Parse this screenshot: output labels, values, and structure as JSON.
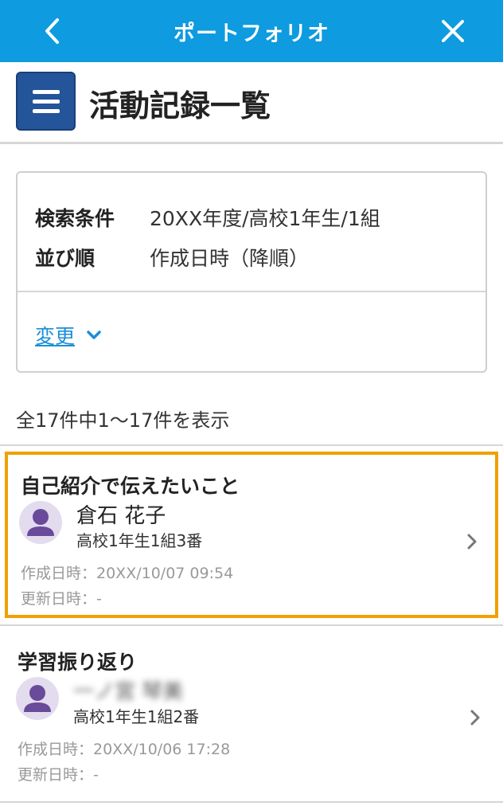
{
  "topbar": {
    "title": "ポートフォリオ",
    "back_icon": "chevron-left-icon",
    "close_icon": "close-icon",
    "color": "#0e9be0"
  },
  "header": {
    "menu_icon": "hamburger-menu-icon",
    "title": "活動記録一覧"
  },
  "search": {
    "condition_label": "検索条件",
    "condition_value": "20XX年度/高校1年生/1組",
    "order_label": "並び順",
    "order_value": "作成日時（降順）",
    "change_label": "変更"
  },
  "count_text": "全17件中1～17件を表示",
  "items": [
    {
      "title": "自己紹介で伝えたいこと",
      "name": "倉石 花子",
      "grade": "高校1年生1組3番",
      "created": "作成日時：20XX/10/07 09:54",
      "updated": "更新日時：-",
      "selected": true
    },
    {
      "title": "学習振り返り",
      "name": "一ノ宮 琴美",
      "grade": "高校1年生1組2番",
      "created": "作成日時：20XX/10/06 17:28",
      "updated": "更新日時：-",
      "selected": false
    }
  ],
  "colors": {
    "menu_button": "#24549a",
    "link": "#1a8fd6",
    "highlight": "#f0a000",
    "avatar_bg": "#e3dcef",
    "avatar_fg": "#6a4a9a"
  }
}
